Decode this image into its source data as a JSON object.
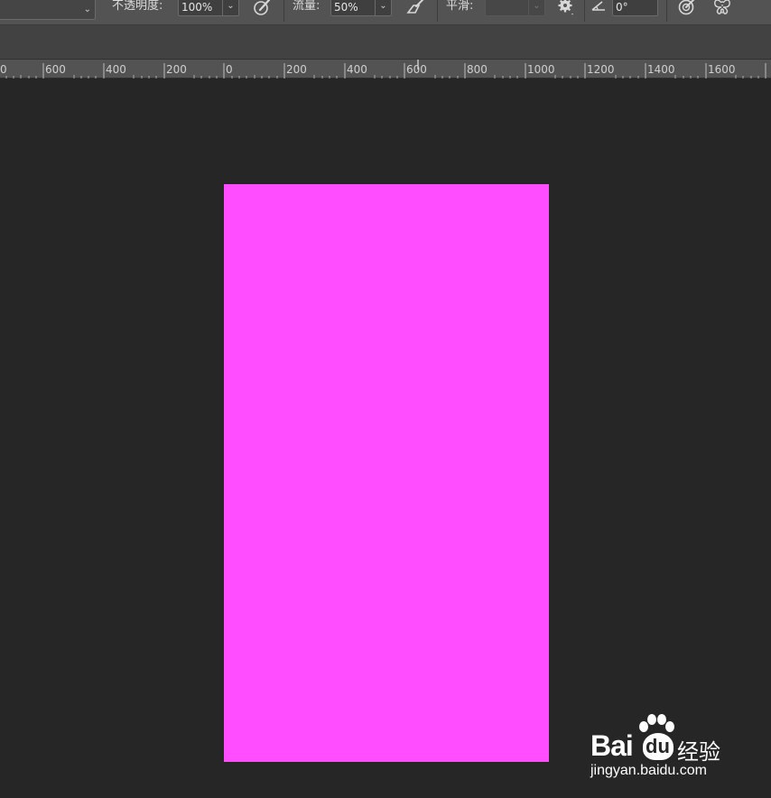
{
  "toolbar": {
    "opacity_label": "不透明度:",
    "opacity_value": "100%",
    "flow_label": "流量:",
    "flow_value": "50%",
    "smoothing_label": "平滑:",
    "smoothing_value": "",
    "angle_value": "0°"
  },
  "ruler": {
    "labels": [
      "0",
      "600",
      "400",
      "200",
      "0",
      "200",
      "400",
      "600",
      "800",
      "1000",
      "1200",
      "1400",
      "1600"
    ]
  },
  "canvas": {
    "fill_color": "#ff4dff",
    "background_color": "#262626"
  },
  "watermark": {
    "brand_latin": "Bai",
    "brand_du": "du",
    "brand_cn": "经验",
    "url": "jingyan.baidu.com"
  }
}
